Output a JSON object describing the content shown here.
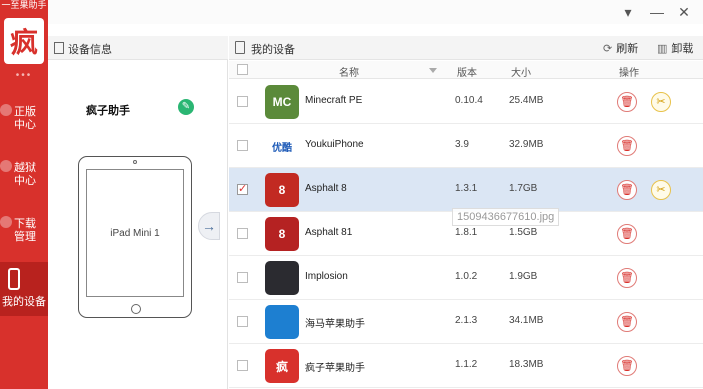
{
  "brand": {
    "strip_text": "一至果助手",
    "logo_glyph": "疯"
  },
  "sidebar": {
    "dots": "•••",
    "items": [
      {
        "label": "正版\n中心"
      },
      {
        "label": "越狱\n中心"
      },
      {
        "label": "下载\n管理"
      },
      {
        "label": "我的设备"
      }
    ]
  },
  "titlebar": {
    "menu": "▾",
    "minimize": "—",
    "close": "✕"
  },
  "device_panel": {
    "title": "设备信息",
    "device_name": "疯子助手",
    "model": "iPad Mini 1",
    "arrow": "→"
  },
  "main": {
    "title": "我的设备",
    "refresh_label": "刷新",
    "uninstall_label": "卸载",
    "columns": {
      "name": "名称",
      "version": "版本",
      "size": "大小",
      "action": "操作"
    },
    "rows": [
      {
        "name": "Minecraft PE",
        "version": "0.10.4",
        "size": "25.4MB",
        "checked": false,
        "tool": true,
        "icon_text": "MC",
        "icon_color": "#5b8a3a"
      },
      {
        "name": "YoukuiPhone",
        "version": "3.9",
        "size": "32.9MB",
        "checked": false,
        "tool": false,
        "icon_text": "优酷",
        "icon_color": "#ffffff"
      },
      {
        "name": "Asphalt 8",
        "version": "1.3.1",
        "size": "1.7GB",
        "checked": true,
        "tool": true,
        "icon_text": "8",
        "icon_color": "#c22a22"
      },
      {
        "name": "Asphalt 81",
        "version": "1.8.1",
        "size": "1.5GB",
        "checked": false,
        "tool": false,
        "icon_text": "8",
        "icon_color": "#b52222"
      },
      {
        "name": "Implosion",
        "version": "1.0.2",
        "size": "1.9GB",
        "checked": false,
        "tool": false,
        "icon_text": "",
        "icon_color": "#2b2b30"
      },
      {
        "name": "海马苹果助手",
        "version": "2.1.3",
        "size": "34.1MB",
        "checked": false,
        "tool": false,
        "icon_text": "",
        "icon_color": "#1d7fd1"
      },
      {
        "name": "疯子苹果助手",
        "version": "1.1.2",
        "size": "18.3MB",
        "checked": false,
        "tool": false,
        "icon_text": "疯",
        "icon_color": "#d8312c"
      }
    ]
  },
  "watermark": "1509436677610.jpg",
  "colors": {
    "accent": "#d8312c",
    "selected_row": "#dbe6f4"
  }
}
